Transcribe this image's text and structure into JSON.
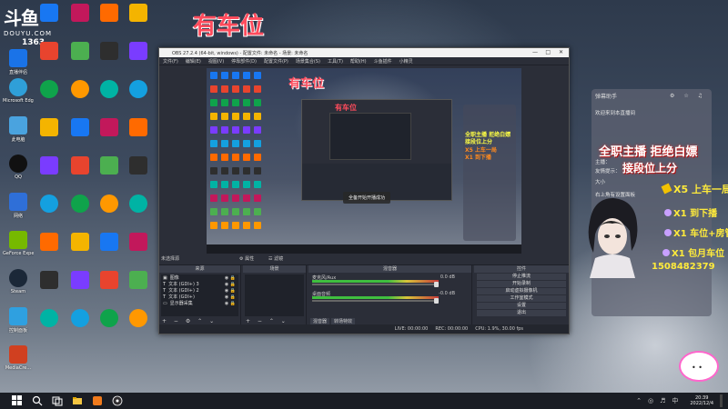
{
  "overlay_title": "有车位",
  "douyu": {
    "logo": "斗鱼",
    "domain": "DOUYU.COM",
    "number": "1363"
  },
  "desktop_icons": [
    {
      "label": "直播伴侣",
      "color": "#1a73e8"
    },
    {
      "label": "此电脑",
      "color": "#4aa3df"
    },
    {
      "label": "回收站",
      "color": "#8ab4f8"
    },
    {
      "label": "Microsoft Edge",
      "color": "#2f9fd8"
    },
    {
      "label": "回收站",
      "color": "#4caf50"
    },
    {
      "label": "QQ",
      "color": "#222"
    },
    {
      "label": "网络",
      "color": "#2f6fd8"
    },
    {
      "label": "GeForce Experience",
      "color": "#76b900"
    },
    {
      "label": "OBS Studio",
      "color": "#333"
    },
    {
      "label": "Steam",
      "color": "#1b2838"
    },
    {
      "label": "控制面板",
      "color": "#2fa0e0"
    },
    {
      "label": "MediaCre...",
      "color": "#d04020"
    }
  ],
  "obs": {
    "window_title": "OBS 27.2.4 (64-bit, windows) - 配置文件: 未命名 - 场景: 未命名",
    "menu": [
      "文件(F)",
      "编辑(E)",
      "视图(V)",
      "停靠部件(D)",
      "配置文件(P)",
      "场景集合(S)",
      "工具(T)",
      "帮助(H)",
      "斗鱼插件",
      "小精灵"
    ],
    "preview_title": "有车位",
    "toast": "全备开始开播成功",
    "no_source": "未选择源",
    "properties": "属性",
    "filters": "滤镜",
    "docks": {
      "scenes": "场景",
      "sources": "来源",
      "mixer": "混音器",
      "controls": "控件"
    },
    "sources": [
      {
        "name": "图像"
      },
      {
        "name": "文本 (GDI+) 3"
      },
      {
        "name": "文本 (GDI+) 2"
      },
      {
        "name": "文本 (GDI+)"
      },
      {
        "name": "显示器采集"
      }
    ],
    "mixer": [
      {
        "label": "麦克风/Aux",
        "db": "0.0 dB"
      },
      {
        "label": "桌面音频",
        "db": "-0.0 dB"
      }
    ],
    "mixer_tabs": [
      "混音器",
      "转场特效"
    ],
    "controls": [
      "停止推流",
      "开始录制",
      "启动虚拟摄像机",
      "工作室模式",
      "设置",
      "退出"
    ],
    "status": {
      "live": "LIVE: 00:00:00",
      "rec": "REC: 00:00:00",
      "cpu": "CPU: 1.9%, 30.00 fps"
    }
  },
  "chat": {
    "header": "弹幕助手",
    "lines": [
      "欢迎来到本直播间",
      "主播：",
      "友情提示：",
      "大小",
      "右上角有设置面板"
    ]
  },
  "promo": {
    "line1": "全职主播 拒绝白嫖",
    "line2": "接段位上分",
    "line3": "X5 上车一局",
    "line4": "X1 到下播",
    "line5": "X1 车位+房管",
    "line6": "X1 包月车位",
    "line7": "1508482379"
  },
  "taskbar": {
    "time": "20:39",
    "date": "2022/12/4"
  }
}
